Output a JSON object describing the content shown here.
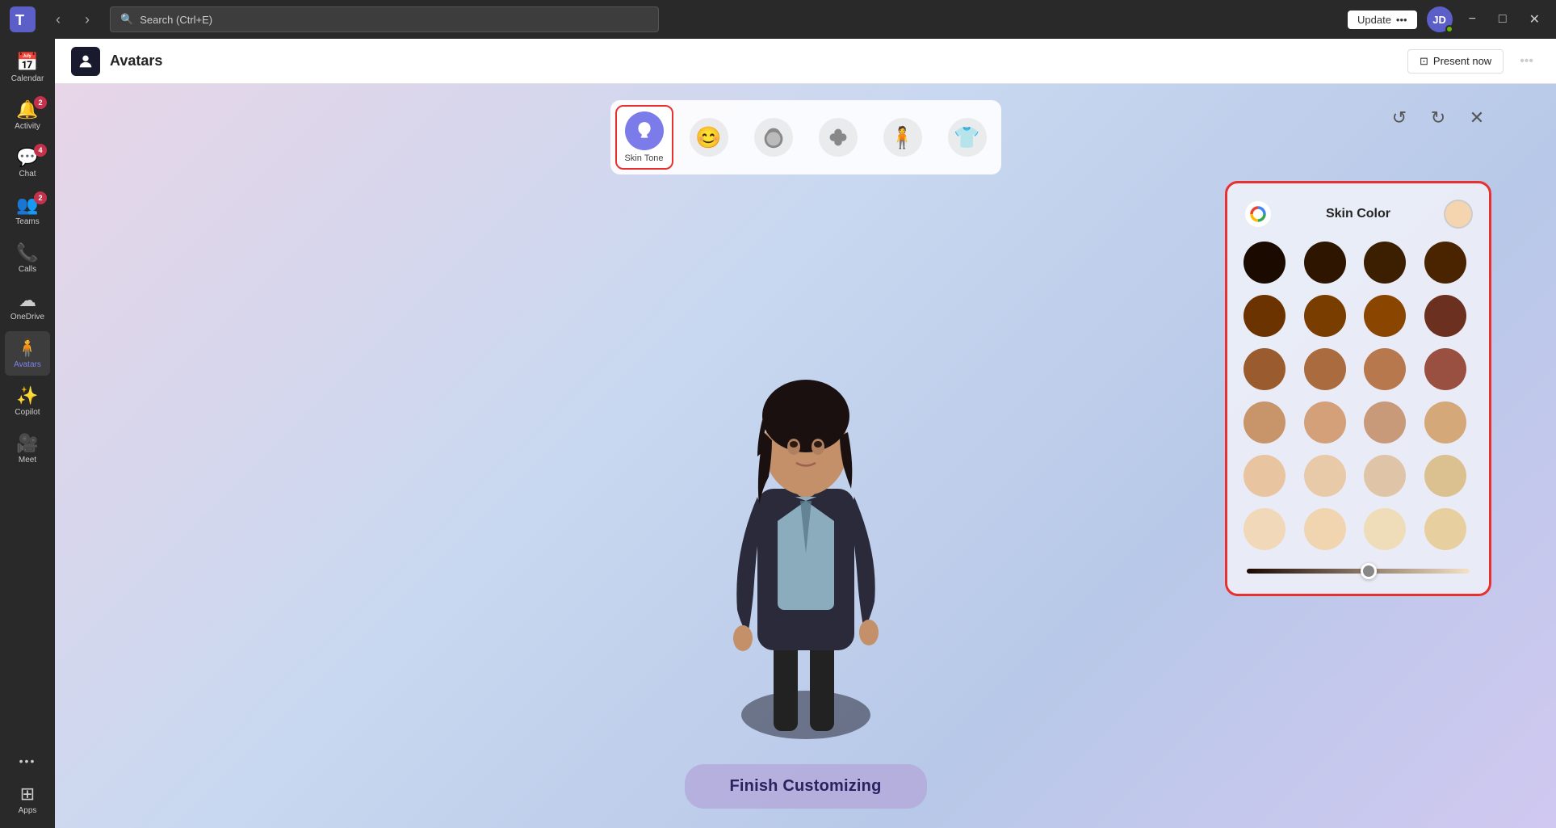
{
  "titleBar": {
    "searchPlaceholder": "Search (Ctrl+E)",
    "updateLabel": "Update",
    "updateDots": "•••",
    "minimize": "−",
    "maximize": "□",
    "close": "✕"
  },
  "sidebar": {
    "items": [
      {
        "id": "calendar",
        "label": "Calendar",
        "icon": "📅",
        "badge": null,
        "active": false
      },
      {
        "id": "activity",
        "label": "Activity",
        "icon": "🔔",
        "badge": "2",
        "active": false
      },
      {
        "id": "chat",
        "label": "Chat",
        "icon": "💬",
        "badge": "4",
        "active": false
      },
      {
        "id": "teams",
        "label": "Teams",
        "icon": "👥",
        "badge": "2",
        "active": false
      },
      {
        "id": "calls",
        "label": "Calls",
        "icon": "📞",
        "badge": null,
        "active": false
      },
      {
        "id": "onedrive",
        "label": "OneDrive",
        "icon": "☁",
        "badge": null,
        "active": false
      },
      {
        "id": "avatars",
        "label": "Avatars",
        "icon": "🧍",
        "badge": null,
        "active": true
      },
      {
        "id": "copilot",
        "label": "Copilot",
        "icon": "✨",
        "badge": null,
        "active": false
      },
      {
        "id": "meet",
        "label": "Meet",
        "icon": "🎥",
        "badge": null,
        "active": false
      },
      {
        "id": "more",
        "label": "···",
        "icon": "···",
        "badge": null,
        "active": false
      },
      {
        "id": "apps",
        "label": "Apps",
        "icon": "⊞",
        "badge": null,
        "active": false
      }
    ]
  },
  "header": {
    "title": "Avatars",
    "presentLabel": "Present now",
    "moreIcon": "•••"
  },
  "toolbar": {
    "items": [
      {
        "id": "skin-tone",
        "label": "Skin Tone",
        "active": true
      },
      {
        "id": "face",
        "label": "",
        "active": false
      },
      {
        "id": "hair",
        "label": "",
        "active": false
      },
      {
        "id": "body",
        "label": "",
        "active": false
      },
      {
        "id": "pose",
        "label": "",
        "active": false
      },
      {
        "id": "outfit",
        "label": "",
        "active": false
      }
    ],
    "undoTitle": "Undo",
    "redoTitle": "Redo",
    "closeTitle": "Close"
  },
  "finishButton": {
    "label": "Finish Customizing"
  },
  "skinPanel": {
    "title": "Skin Color",
    "colors": [
      "#1a0a00",
      "#2d1500",
      "#3b1f00",
      "#4a2400",
      "#6b3300",
      "#7a3d00",
      "#8a4500",
      "#6b3020",
      "#9a5c2e",
      "#aa6c3e",
      "#b8784e",
      "#9a5040",
      "#c8956a",
      "#d4a07a",
      "#c89a7a",
      "#d4a878",
      "#e8c4a0",
      "#e8caa8",
      "#e0c4a8",
      "#dbc090",
      "#f0d8b8",
      "#f0d5b0",
      "#eeddb8",
      "#e8cfa0"
    ],
    "selectedColor": "#f5d5b0",
    "sliderValue": 55
  }
}
